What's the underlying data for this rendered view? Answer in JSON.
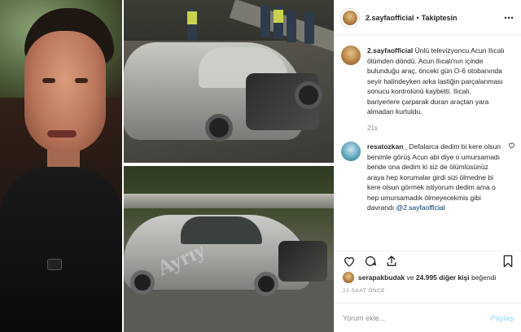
{
  "header": {
    "username": "2.sayfaofficial",
    "separator": "•",
    "follow_status": "Takiptesin",
    "more_icon": "⋯"
  },
  "comments": [
    {
      "username": "2.sayfaofficial",
      "text": "Ünlü televizyoncu Acun Ilıcalı ölümden döndü. Acun Ilıcalı'nın içinde bulunduğu araç, önceki gün O-6 otobanında seyir halindeyken arka lastiğin parçalanması sonucu kontrolünü kaybetti. Ilıcalı, bariyerlere çarparak duran araçtan yara almadan kurtuldu.",
      "time": "21s"
    },
    {
      "username": "resatozkan_",
      "text": "Defalarca dedim bi kere olsun benimle görüş Acun abi diye o umursamadı bende ona dedim ki siz de ölümlüsünüz araya hep korumalar girdi sizi ölmedne bi kere olsun görmek istiyorum dedim ama o hep umursamadık ölmeyecekmis gibi davrandı",
      "mention": "@2.sayfaofficial"
    }
  ],
  "likes": {
    "user": "serapakbudak",
    "middle": "ve",
    "count": "24.995 diğer kişi",
    "suffix": "beğendi"
  },
  "timestamp": "21 SAAT ÖNCE",
  "comment_input": {
    "placeholder": "Yorum ekle...",
    "post_label": "Paylaş"
  },
  "watermark": "Ayrıy",
  "icons": [
    "heart-icon",
    "comment-icon",
    "share-icon",
    "bookmark-icon",
    "more-icon"
  ],
  "colors": {
    "mention": "#00376b",
    "muted": "#8e8e8e",
    "post_disabled": "#b2dffc"
  }
}
